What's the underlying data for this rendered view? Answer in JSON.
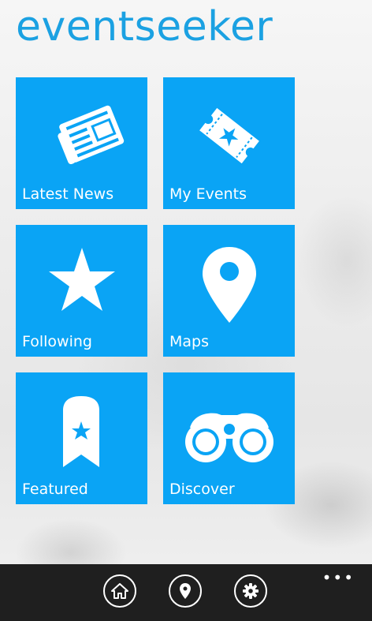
{
  "app": {
    "title": "eventseeker"
  },
  "tiles": [
    {
      "label": "Latest News",
      "icon": "newspaper-icon"
    },
    {
      "label": "My Events",
      "icon": "ticket-icon"
    },
    {
      "label": "Following",
      "icon": "star-icon"
    },
    {
      "label": "Maps",
      "icon": "map-pin-icon"
    },
    {
      "label": "Featured",
      "icon": "bookmark-star-icon"
    },
    {
      "label": "Discover",
      "icon": "binoculars-icon"
    }
  ],
  "appbar": {
    "buttons": [
      {
        "icon": "home-icon"
      },
      {
        "icon": "location-icon"
      },
      {
        "icon": "settings-icon"
      }
    ],
    "more": "•••"
  },
  "colors": {
    "accent": "#1ba1e2",
    "tile": "#0aa4f5",
    "appbar": "#1f1f1f"
  }
}
